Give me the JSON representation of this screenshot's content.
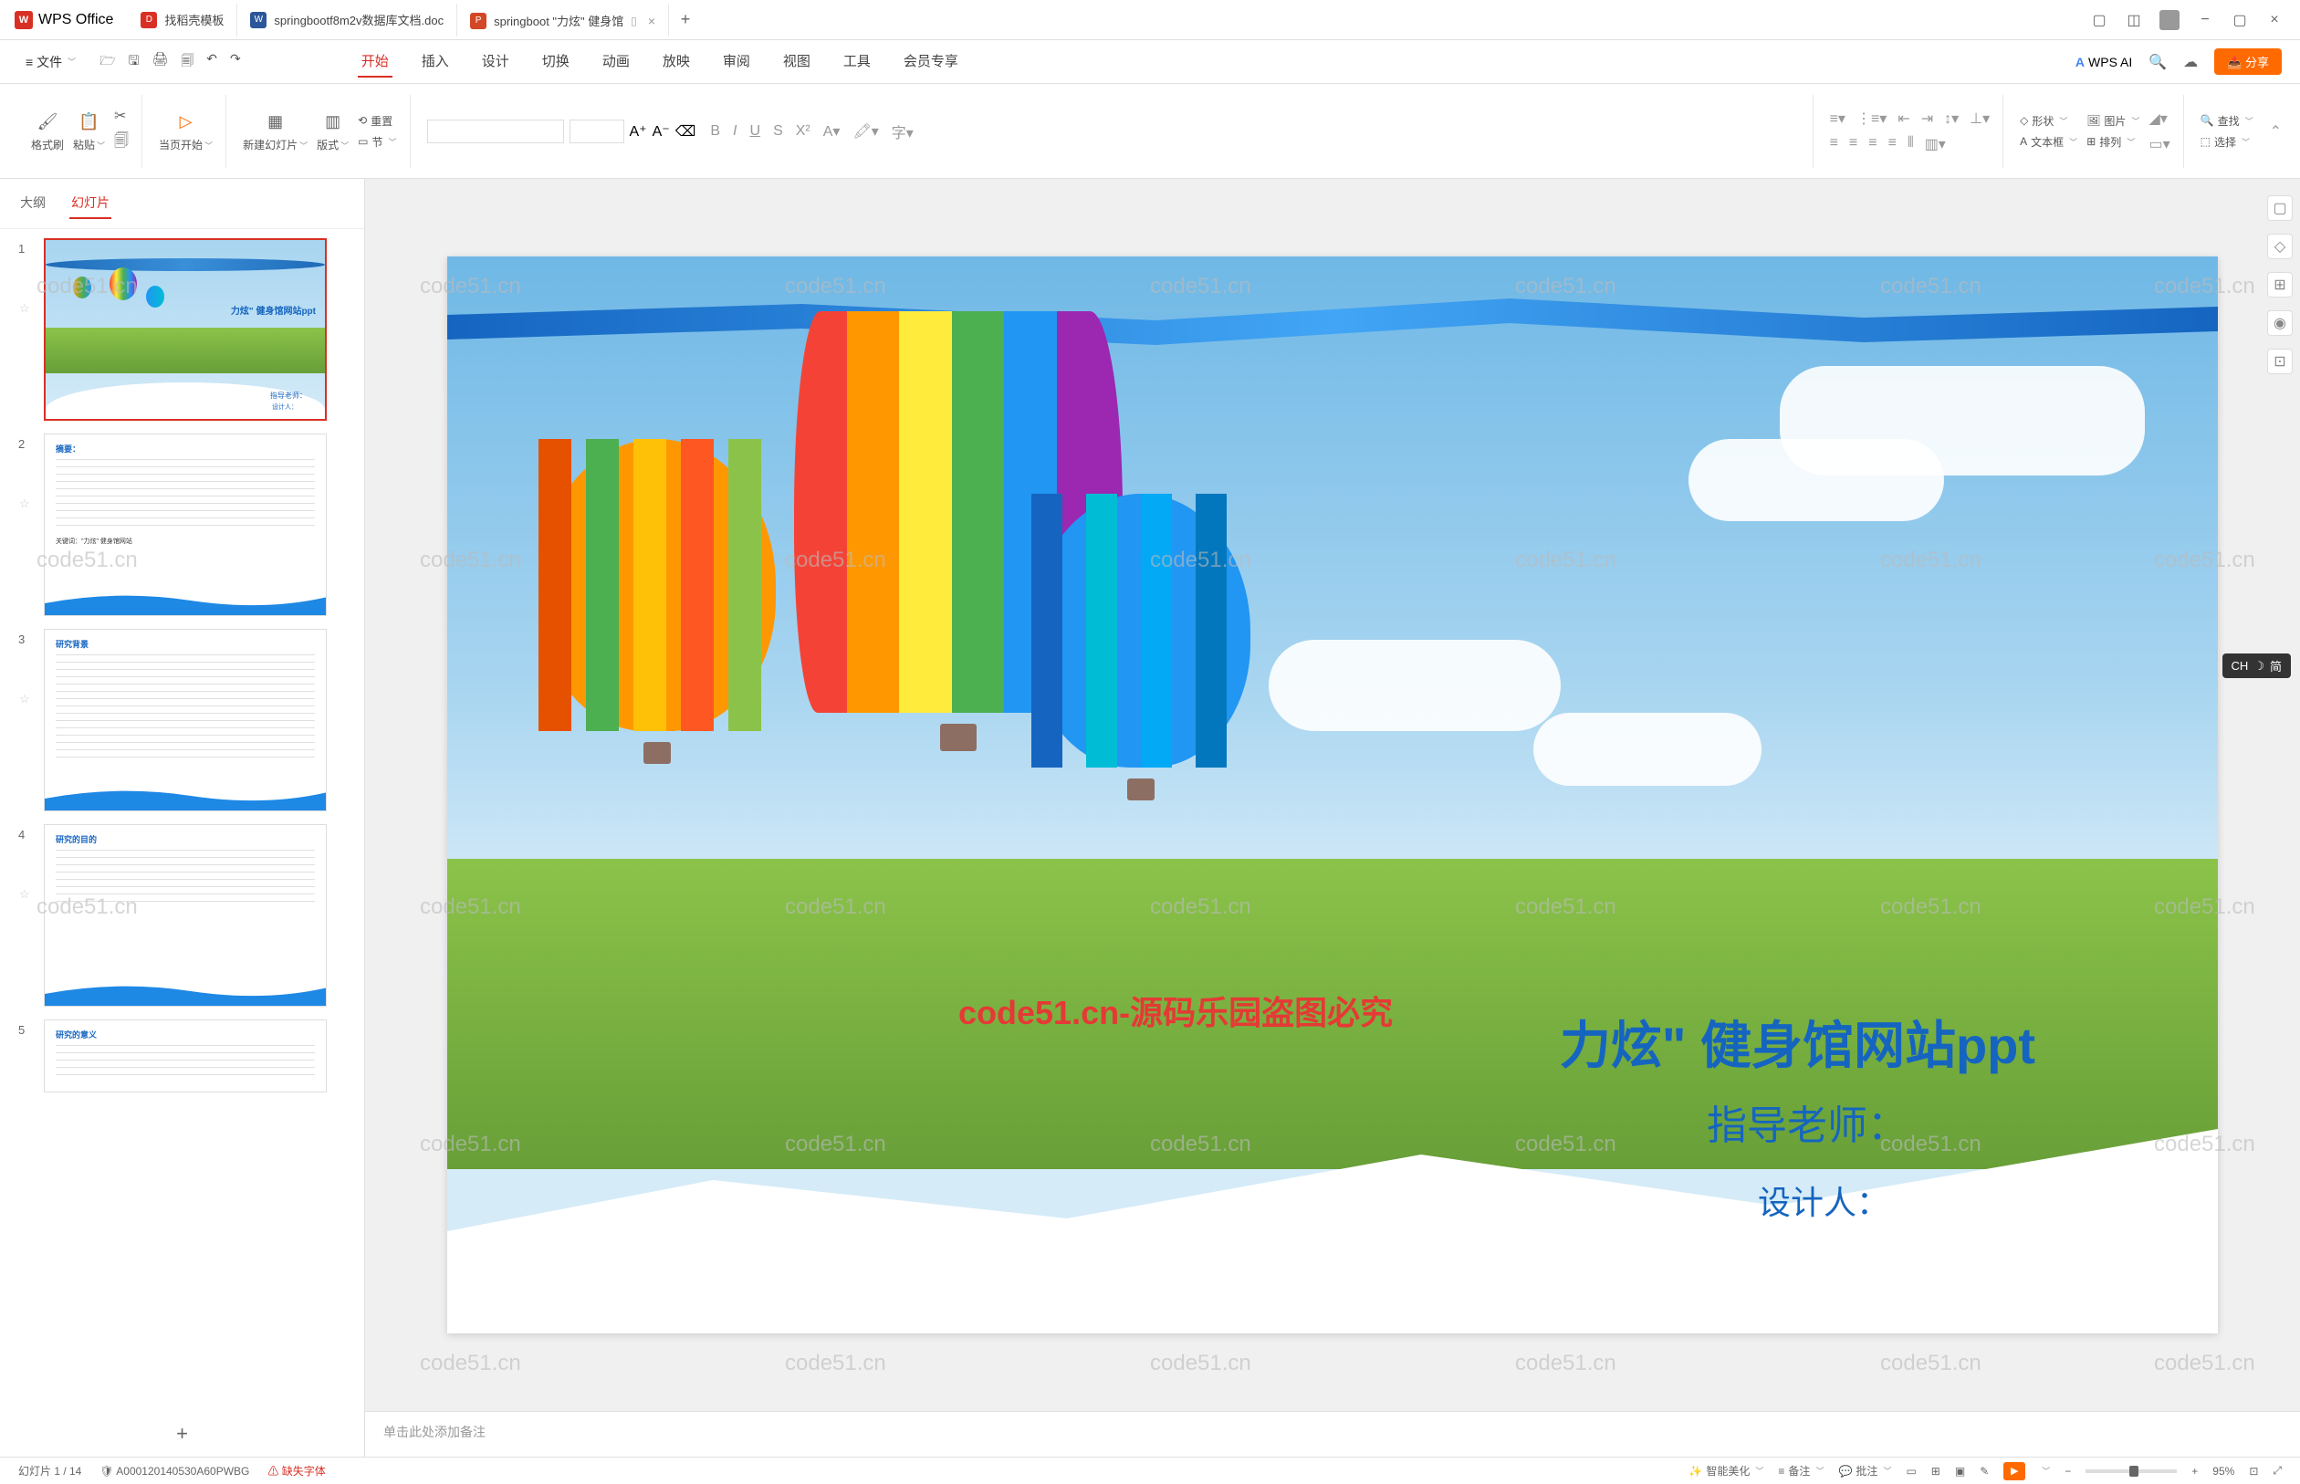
{
  "app": {
    "name": "WPS Office"
  },
  "tabs": [
    {
      "label": "找稻壳模板",
      "iconColor": "#d93025",
      "iconText": "D"
    },
    {
      "label": "springbootf8m2v数据库文档.doc",
      "iconColor": "#2b579a",
      "iconText": "W"
    },
    {
      "label": "springboot \"力炫\" 健身馆",
      "iconColor": "#d24726",
      "iconText": "P",
      "active": true
    }
  ],
  "menu": {
    "file": "文件",
    "items": [
      "开始",
      "插入",
      "设计",
      "切换",
      "动画",
      "放映",
      "审阅",
      "视图",
      "工具",
      "会员专享"
    ],
    "active": "开始",
    "ai": "WPS AI",
    "share": "分享"
  },
  "ribbon": {
    "format": "格式刷",
    "paste": "粘贴",
    "start": "当页开始",
    "newSlide": "新建幻灯片",
    "layout": "版式",
    "section": "节",
    "reset": "重置",
    "shape": "形状",
    "picture": "图片",
    "textbox": "文本框",
    "arrange": "排列",
    "find": "查找",
    "select": "选择"
  },
  "side": {
    "outline": "大纲",
    "slides": "幻灯片"
  },
  "thumbs": [
    {
      "num": "1",
      "title": "力炫\" 健身馆网站ppt",
      "sub1": "指导老师：",
      "sub2": "设计人："
    },
    {
      "num": "2",
      "heading": "摘要：",
      "kw": "关键词：\"力炫\" 健身馆网站"
    },
    {
      "num": "3",
      "heading": "研究背景"
    },
    {
      "num": "4",
      "heading": "研究的目的"
    },
    {
      "num": "5",
      "heading": "研究的意义"
    }
  ],
  "slide": {
    "title": "力炫\" 健身馆网站ppt",
    "sub1": "指导老师：",
    "sub2": "设计人：",
    "wmRed": "code51.cn-源码乐园盗图必究",
    "wm": "code51.cn"
  },
  "notes": {
    "placeholder": "单击此处添加备注"
  },
  "status": {
    "slide": "幻灯片 1 / 14",
    "id": "A000120140530A60PWBG",
    "warn": "缺失字体",
    "beautify": "智能美化",
    "notesBtn": "备注",
    "review": "批注",
    "zoom": "95%"
  },
  "ime": {
    "lang": "CH",
    "mode": "简"
  }
}
